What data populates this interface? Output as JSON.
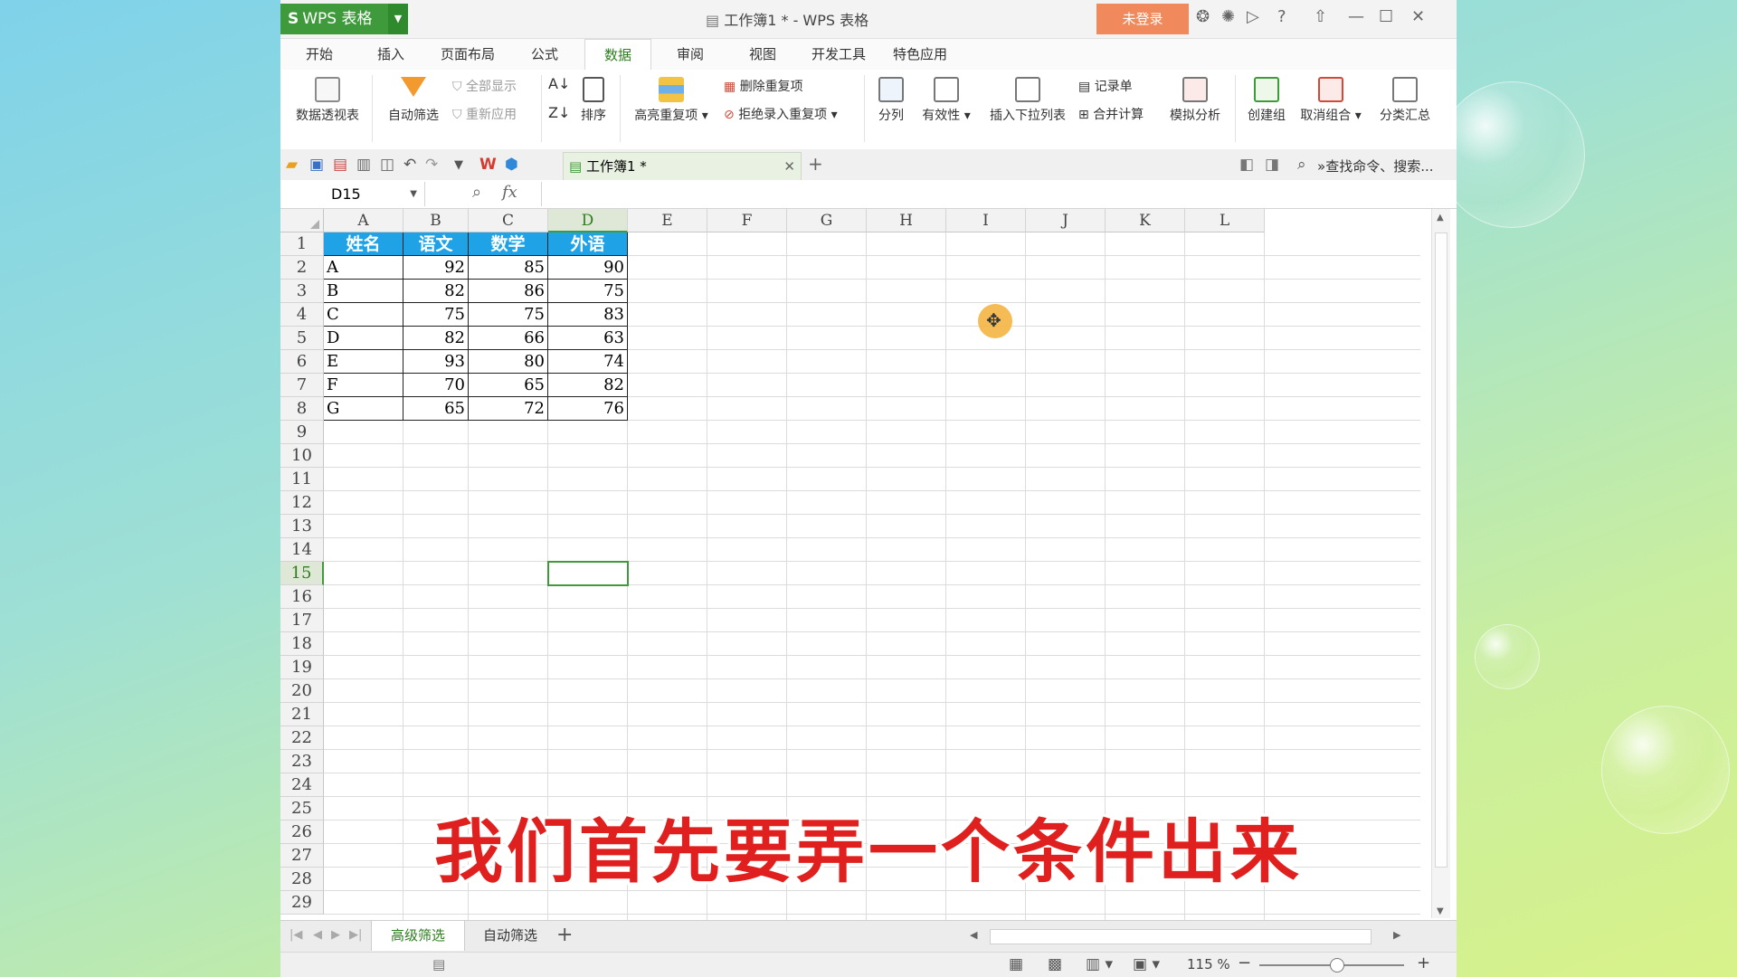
{
  "titlebar": {
    "app_button": "WPS 表格",
    "window_title": "工作簿1 * - WPS 表格",
    "login": "未登录",
    "help": "?"
  },
  "menu_tabs": [
    "开始",
    "插入",
    "页面布局",
    "公式",
    "数据",
    "审阅",
    "视图",
    "开发工具",
    "特色应用"
  ],
  "active_tab": "数据",
  "ribbon": {
    "pivot": "数据透视表",
    "auto_filter": "自动筛选",
    "show_all": "全部显示",
    "reapply": "重新应用",
    "sort": "排序",
    "highlight_dup": "高亮重复项",
    "remove_dup": "删除重复项",
    "reject_dup": "拒绝录入重复项",
    "split": "分列",
    "validity": "有效性",
    "insert_dropdown": "插入下拉列表",
    "record": "记录单",
    "merge_calc": "合并计算",
    "whatif": "模拟分析",
    "create_group": "创建组",
    "ungroup": "取消组合",
    "subtotal": "分类汇总"
  },
  "doc_tab": "工作簿1 *",
  "search_placeholder": "查找命令、搜索...",
  "formula_bar": {
    "name_box": "D15",
    "fx": "fx",
    "value": ""
  },
  "columns": [
    "A",
    "B",
    "C",
    "D",
    "E",
    "F",
    "G",
    "H",
    "I",
    "J",
    "K",
    "L"
  ],
  "selected_column": "D",
  "rows_visible": [
    "1",
    "2",
    "3",
    "4",
    "5",
    "6",
    "7",
    "8",
    "9",
    "10",
    "11",
    "12",
    "13",
    "14",
    "15",
    "16",
    "17",
    "18",
    "19",
    "20",
    "21",
    "22",
    "23",
    "24",
    "25",
    "26",
    "27",
    "28",
    "29"
  ],
  "selected_row": "15",
  "active_cell": "D15",
  "table": {
    "headers": [
      "姓名",
      "语文",
      "数学",
      "外语"
    ],
    "rows": [
      [
        "A",
        "92",
        "85",
        "90"
      ],
      [
        "B",
        "82",
        "86",
        "75"
      ],
      [
        "C",
        "75",
        "75",
        "83"
      ],
      [
        "D",
        "82",
        "66",
        "63"
      ],
      [
        "E",
        "93",
        "80",
        "74"
      ],
      [
        "F",
        "70",
        "65",
        "82"
      ],
      [
        "G",
        "65",
        "72",
        "76"
      ]
    ]
  },
  "sheets": [
    "高级筛选",
    "自动筛选"
  ],
  "active_sheet": "高级筛选",
  "status": {
    "zoom": "115 %"
  },
  "subtitle": "我们首先要弄一个条件出来",
  "colors": {
    "wps_green": "#3e9a3a",
    "header_blue": "#1fa3e6",
    "login_orange": "#f08a5c",
    "subtitle_red": "#e0201e"
  }
}
